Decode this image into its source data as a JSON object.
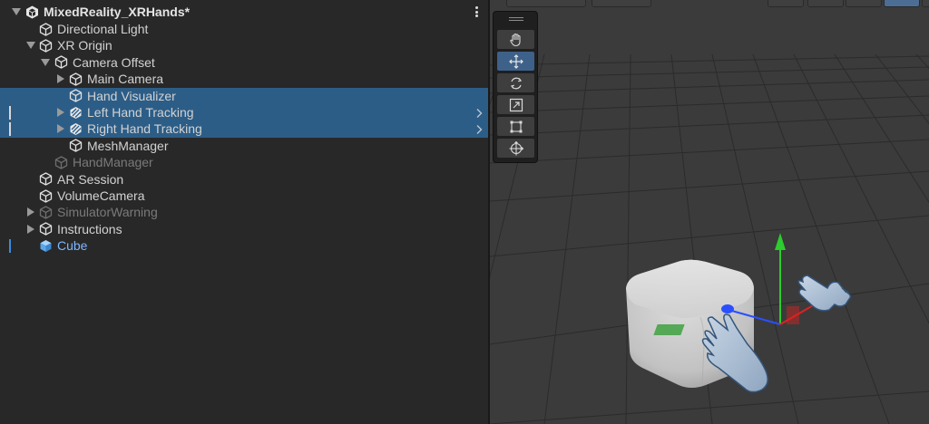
{
  "hierarchy": {
    "scene_name": "MixedReality_XRHands*",
    "items": [
      {
        "label": "Directional Light",
        "depth": 1,
        "arrow": "none",
        "icon": "gameobject-icon",
        "state": "normal"
      },
      {
        "label": "XR Origin",
        "depth": 1,
        "arrow": "expanded",
        "icon": "gameobject-icon",
        "state": "normal"
      },
      {
        "label": "Camera Offset",
        "depth": 2,
        "arrow": "expanded",
        "icon": "gameobject-icon",
        "state": "normal"
      },
      {
        "label": "Main Camera",
        "depth": 3,
        "arrow": "collapsed",
        "icon": "gameobject-icon",
        "state": "normal"
      },
      {
        "label": "Hand Visualizer",
        "depth": 3,
        "arrow": "none",
        "icon": "gameobject-icon",
        "state": "selected"
      },
      {
        "label": "Left Hand Tracking",
        "depth": 3,
        "arrow": "collapsed",
        "icon": "prefab-variant-icon",
        "state": "selected-prefab"
      },
      {
        "label": "Right Hand Tracking",
        "depth": 3,
        "arrow": "collapsed",
        "icon": "prefab-variant-icon",
        "state": "selected-prefab"
      },
      {
        "label": "MeshManager",
        "depth": 3,
        "arrow": "none",
        "icon": "gameobject-icon",
        "state": "normal"
      },
      {
        "label": "HandManager",
        "depth": 2,
        "arrow": "none",
        "icon": "gameobject-icon",
        "state": "disabled"
      },
      {
        "label": "AR Session",
        "depth": 1,
        "arrow": "none",
        "icon": "gameobject-icon",
        "state": "normal"
      },
      {
        "label": "VolumeCamera",
        "depth": 1,
        "arrow": "none",
        "icon": "gameobject-icon",
        "state": "normal"
      },
      {
        "label": "SimulatorWarning",
        "depth": 1,
        "arrow": "collapsed",
        "icon": "gameobject-icon",
        "state": "disabled"
      },
      {
        "label": "Instructions",
        "depth": 1,
        "arrow": "collapsed",
        "icon": "gameobject-icon",
        "state": "normal"
      },
      {
        "label": "Cube",
        "depth": 1,
        "arrow": "none",
        "icon": "cube-prefab-icon",
        "state": "prefab"
      }
    ]
  },
  "scene_tools": [
    {
      "name": "hand-tool",
      "icon": "hand-icon",
      "active": false
    },
    {
      "name": "move-tool",
      "icon": "move-arrows-icon",
      "active": true
    },
    {
      "name": "rotate-tool",
      "icon": "rotate-icon",
      "active": false
    },
    {
      "name": "scale-tool",
      "icon": "scale-icon",
      "active": false
    },
    {
      "name": "rect-tool",
      "icon": "rect-icon",
      "active": false
    },
    {
      "name": "transform-tool",
      "icon": "transform-icon",
      "active": false
    }
  ],
  "colors": {
    "selection": "#2c5d87",
    "panel_bg": "#282828",
    "scene_bg": "#3b3b3b",
    "prefab_text": "#7fb6ff",
    "gizmo_x": "#e02020",
    "gizmo_y": "#2ecc2e",
    "gizmo_z": "#2a4fff"
  }
}
